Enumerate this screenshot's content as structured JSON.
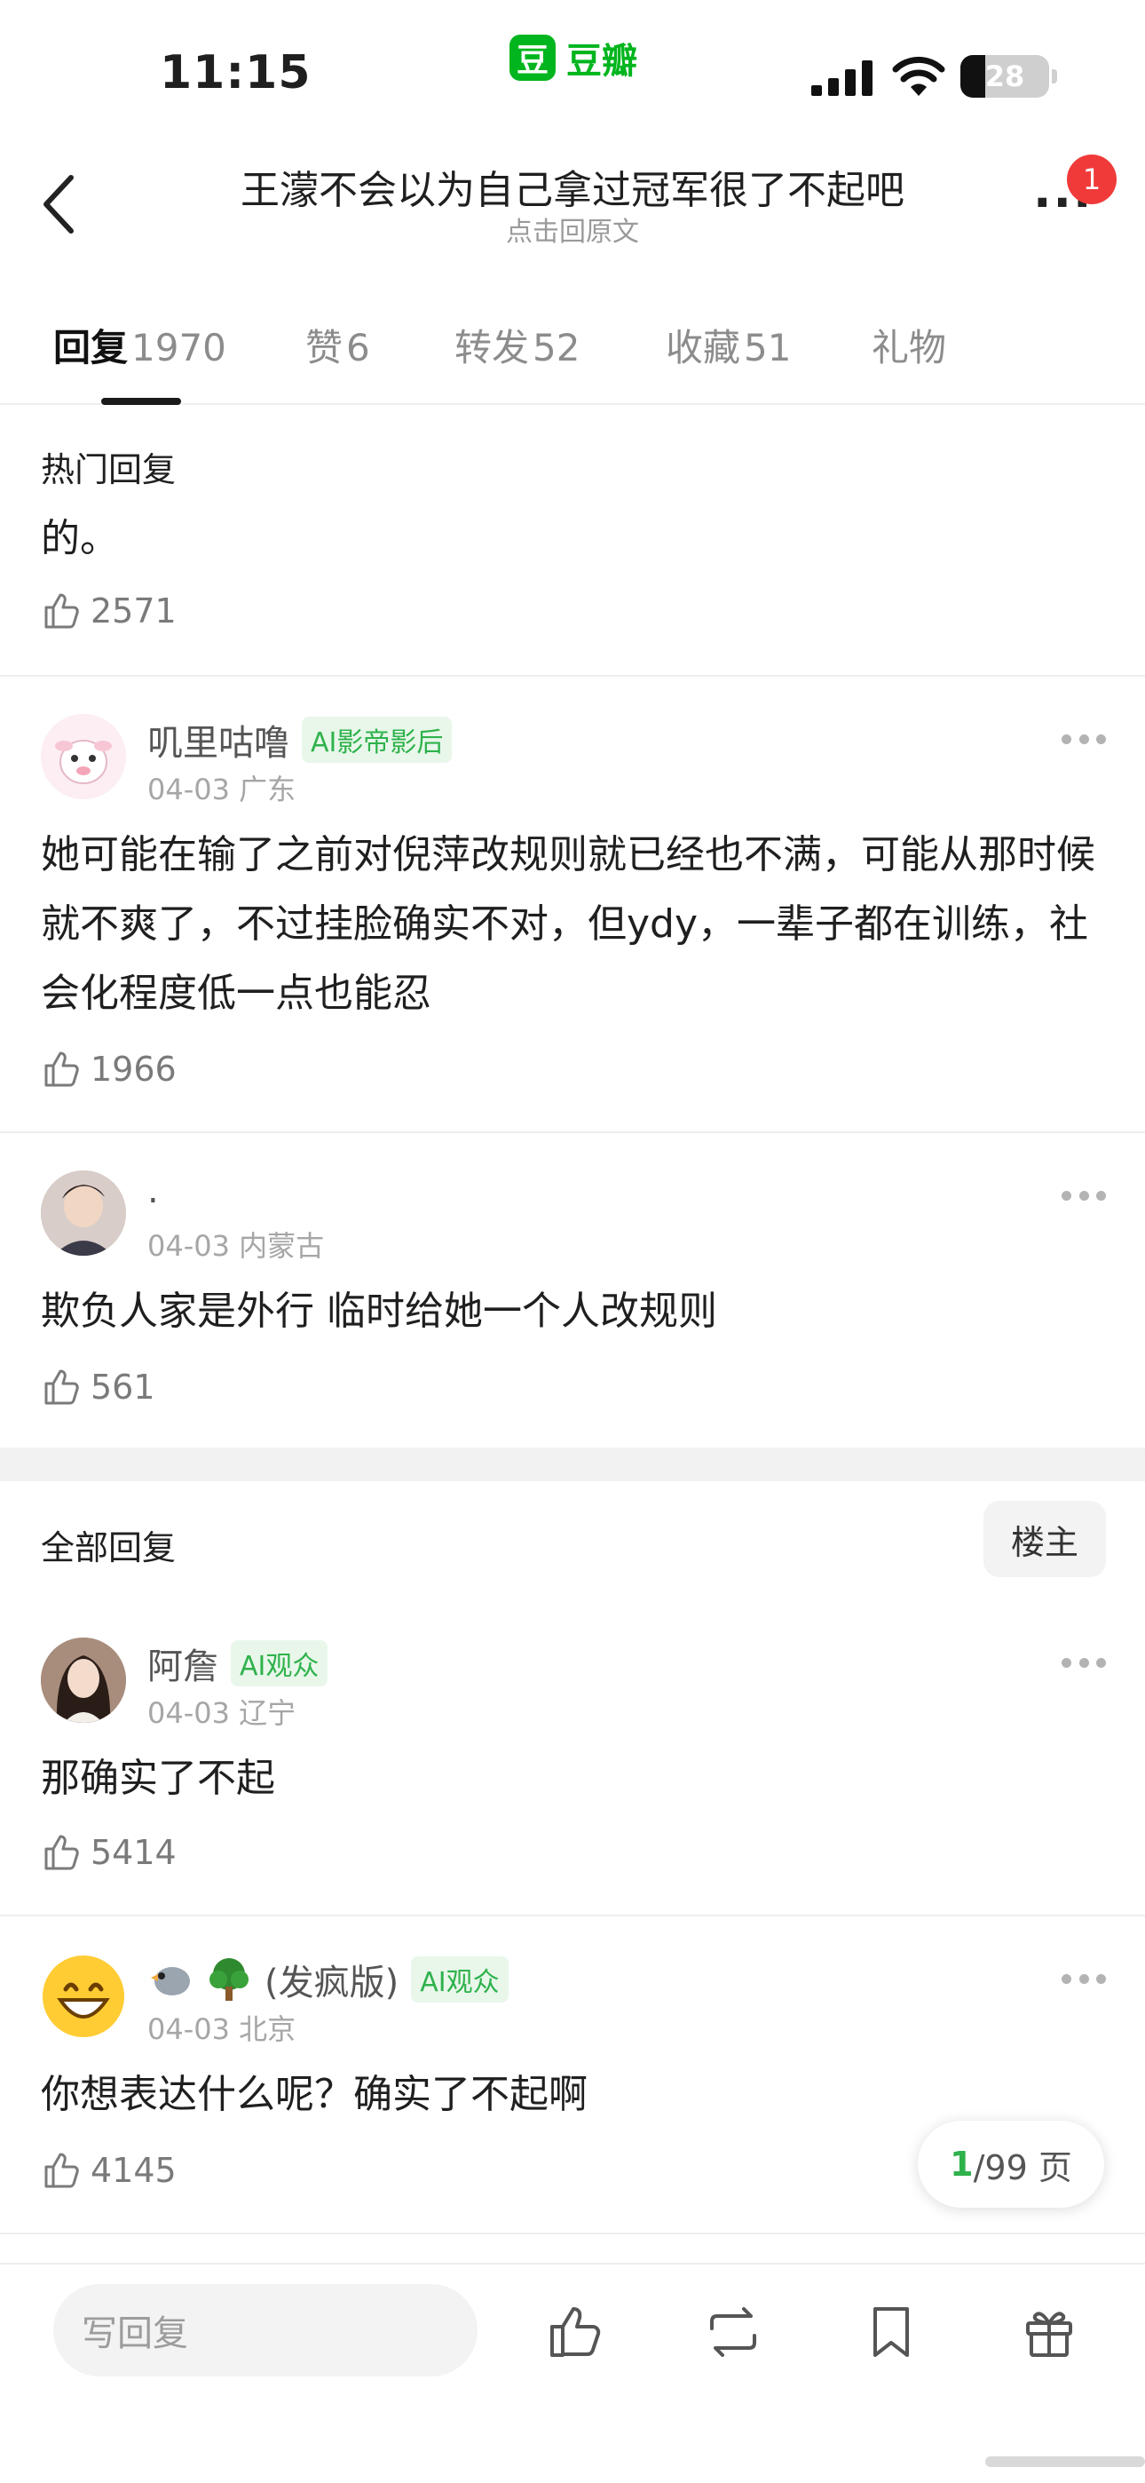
{
  "status_bar": {
    "time": "11:15",
    "app_logo": "豆",
    "app_name": "豆瓣",
    "battery": "28",
    "battery_level_percent": 28
  },
  "nav": {
    "title": "王濛不会以为自己拿过冠军很了不起吧",
    "subtitle": "点击回原文",
    "notification_count": "1"
  },
  "tabs": [
    {
      "label": "回复",
      "count": "1970",
      "active": true
    },
    {
      "label": "赞",
      "count": "6"
    },
    {
      "label": "转发",
      "count": "52"
    },
    {
      "label": "收藏",
      "count": "51"
    },
    {
      "label": "礼物",
      "count": ""
    }
  ],
  "hot": {
    "section_label": "热门回复",
    "top_item": {
      "text": "的。",
      "likes": "2571"
    },
    "comments": [
      {
        "username": "叽里咕噜",
        "badge": "AI影帝影后",
        "date": "04-03",
        "location": "广东",
        "text": "她可能在输了之前对倪萍改规则就已经也不满，可能从那时候就不爽了，不过挂脸确实不对，但ydy，一辈子都在训练，社会化程度低一点也能忍",
        "likes": "1966"
      },
      {
        "username": ".",
        "badge": "",
        "date": "04-03",
        "location": "内蒙古",
        "text": "欺负人家是外行 临时给她一个人改规则",
        "likes": "561"
      }
    ]
  },
  "all": {
    "section_label": "全部回复",
    "owner_button": "楼主",
    "comments": [
      {
        "username": "阿詹",
        "badge": "AI观众",
        "date": "04-03",
        "location": "辽宁",
        "text": "那确实了不起",
        "likes": "5414"
      },
      {
        "username": "(发疯版)",
        "badge": "AI观众",
        "date": "04-03",
        "location": "北京",
        "text": "你想表达什么呢？确实了不起啊",
        "likes": "4145"
      }
    ]
  },
  "pager": {
    "current": "1",
    "total": "/99 页"
  },
  "bottom_bar": {
    "reply_placeholder": "写回复"
  }
}
